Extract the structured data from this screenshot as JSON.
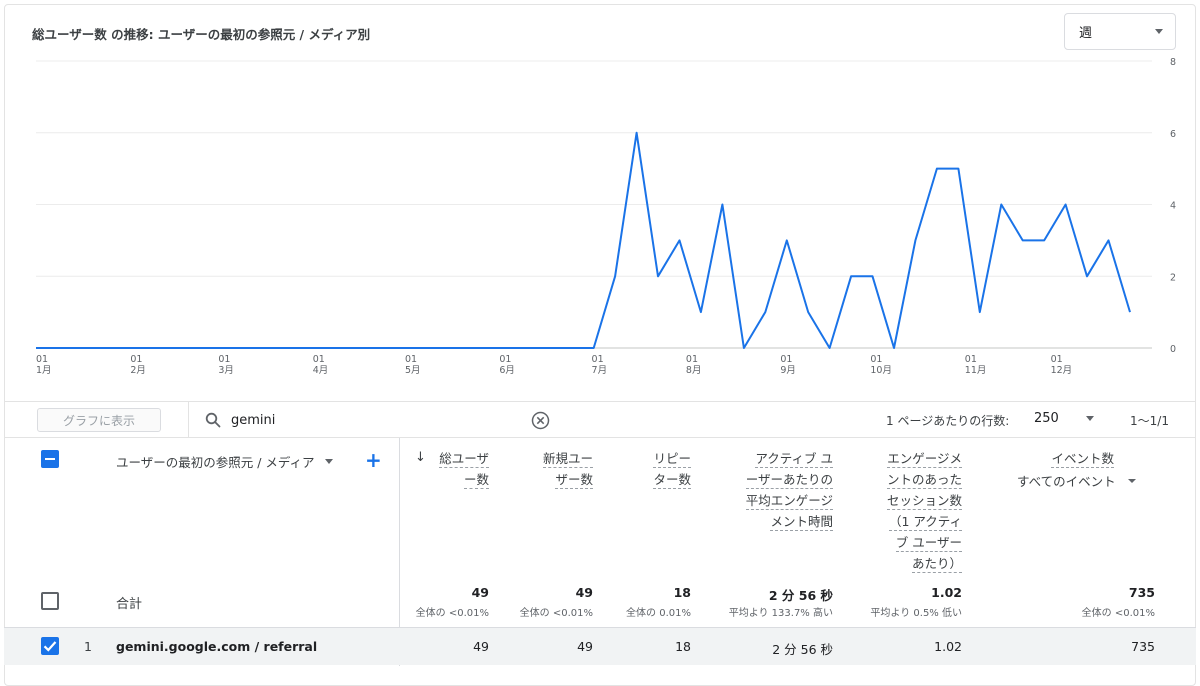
{
  "chart": {
    "title": "総ユーザー数 の推移: ユーザーの最初の参照元 / メディア別",
    "period": "週"
  },
  "chart_data": {
    "type": "line",
    "ylim": [
      0,
      8
    ],
    "y_ticks": [
      "0",
      "2",
      "4",
      "6",
      "8"
    ],
    "x_ticks": [
      {
        "day": "01",
        "month": "1月"
      },
      {
        "day": "01",
        "month": "2月"
      },
      {
        "day": "01",
        "month": "3月"
      },
      {
        "day": "01",
        "month": "4月"
      },
      {
        "day": "01",
        "month": "5月"
      },
      {
        "day": "01",
        "month": "6月"
      },
      {
        "day": "01",
        "month": "7月"
      },
      {
        "day": "01",
        "month": "8月"
      },
      {
        "day": "01",
        "month": "9月"
      },
      {
        "day": "01",
        "month": "10月"
      },
      {
        "day": "01",
        "month": "11月"
      },
      {
        "day": "01",
        "month": "12月"
      }
    ],
    "grid": true,
    "values": [
      0,
      0,
      0,
      0,
      0,
      0,
      0,
      0,
      0,
      0,
      0,
      0,
      0,
      0,
      0,
      0,
      0,
      0,
      0,
      0,
      0,
      0,
      0,
      0,
      0,
      0,
      0,
      2,
      6,
      2,
      3,
      1,
      4,
      0,
      1,
      3,
      1,
      0,
      2,
      2,
      0,
      3,
      5,
      5,
      1,
      4,
      3,
      3,
      4,
      2,
      3,
      1
    ],
    "color": "#1a73e8"
  },
  "toolbar": {
    "graph_button": "グラフに表示",
    "search_value": "gemini",
    "rows_label": "1 ページあたりの行数:",
    "rows_value": "250",
    "pager": "1〜1/1"
  },
  "table": {
    "dimension_header": "ユーザーの最初の参照元 / メディア",
    "metric_headers": [
      [
        "総ユーザ",
        "ー数"
      ],
      [
        "新規ユー",
        "ザー数"
      ],
      [
        "リピー",
        "ター数"
      ],
      [
        "アクティブ ユ",
        "ーザーあたりの",
        "平均エンゲージ",
        "メント時間"
      ],
      [
        "エンゲージメ",
        "ントのあった",
        "セッション数",
        "（1 アクティ",
        "ブ ユーザー",
        "あたり）"
      ],
      [
        "イベント数"
      ]
    ],
    "event_filter": "すべてのイベント",
    "total_label": "合計",
    "totals": [
      {
        "value": "49",
        "sub": "全体の <0.01%"
      },
      {
        "value": "49",
        "sub": "全体の <0.01%"
      },
      {
        "value": "18",
        "sub": "全体の 0.01%"
      },
      {
        "value": "2 分 56 秒",
        "sub": "平均より 133.7% 高い"
      },
      {
        "value": "1.02",
        "sub": "平均より 0.5% 低い"
      },
      {
        "value": "735",
        "sub": "全体の <0.01%"
      }
    ],
    "rows": [
      {
        "index": "1",
        "name": "gemini.google.com / referral",
        "values": [
          "49",
          "49",
          "18",
          "2 分 56 秒",
          "1.02",
          "735"
        ]
      }
    ]
  }
}
